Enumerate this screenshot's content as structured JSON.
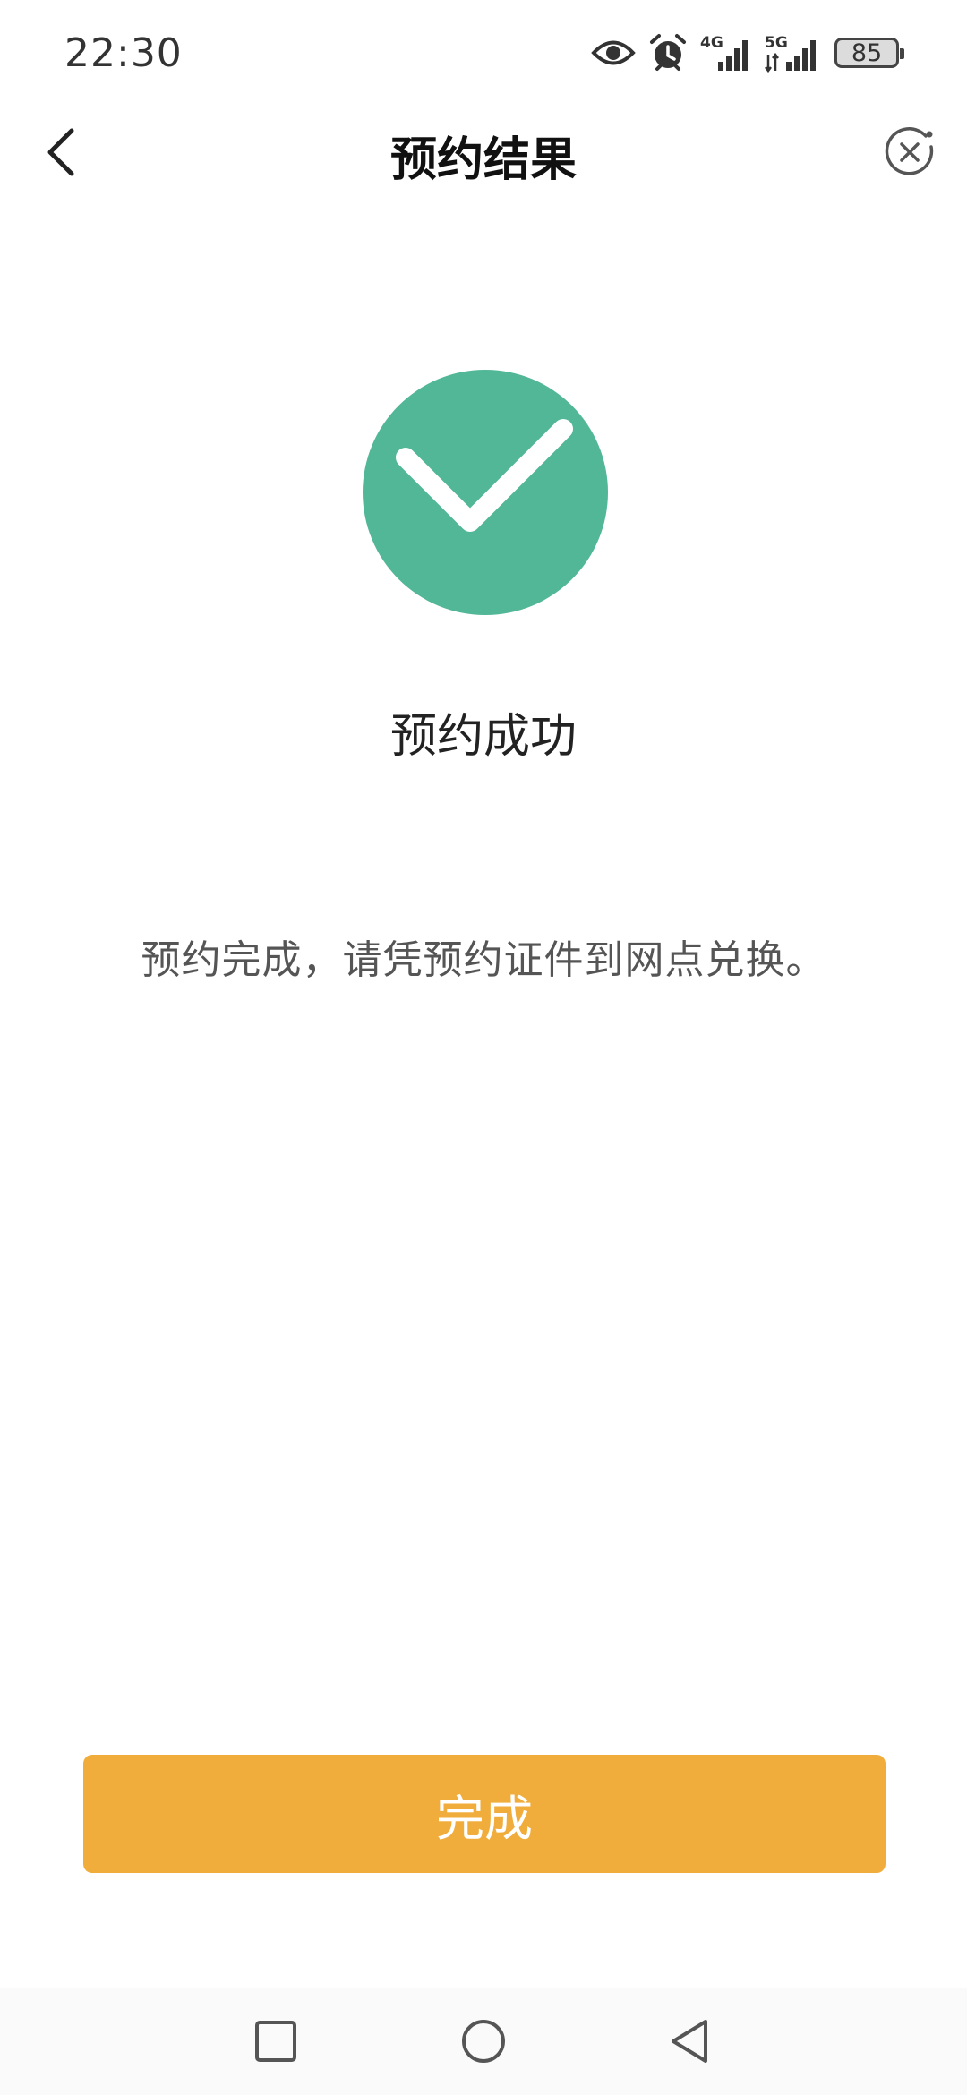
{
  "status_bar": {
    "time": "22:30",
    "network_1": "4G",
    "network_2": "5G",
    "battery": "85",
    "icons": [
      "eye-icon",
      "alarm-icon",
      "signal-4g-icon",
      "signal-5g-icon",
      "battery-icon"
    ]
  },
  "nav": {
    "title": "预约结果",
    "back_icon": "chevron-left-icon",
    "close_icon": "close-circle-icon"
  },
  "result": {
    "icon": "check-circle-icon",
    "status_color": "#52b797",
    "title": "预约成功",
    "message": "预约完成，请凭预约证件到网点兑换。"
  },
  "actions": {
    "done_label": "完成",
    "done_color": "#f0ad3c"
  },
  "system_nav": {
    "icons": [
      "recents-square-icon",
      "home-circle-icon",
      "back-triangle-icon"
    ]
  }
}
